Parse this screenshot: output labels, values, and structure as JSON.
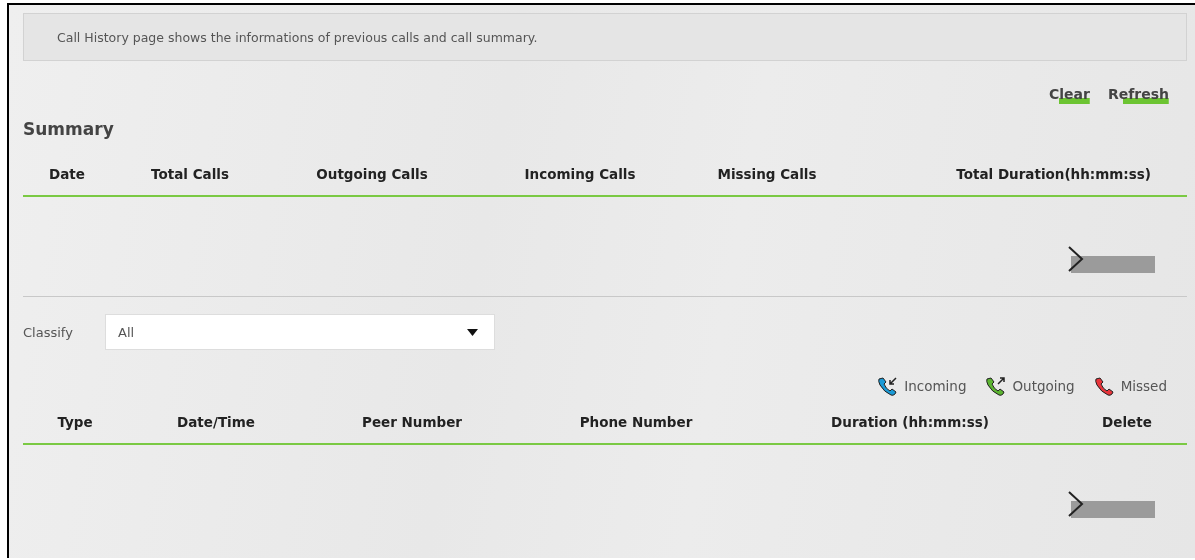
{
  "info_text": "Call History page shows the informations of previous calls and call summary.",
  "actions": [
    "Clear",
    "Refresh"
  ],
  "summary": {
    "title": "Summary",
    "columns": [
      "Date",
      "Total Calls",
      "Outgoing Calls",
      "Incoming Calls",
      "Missing Calls",
      "Total Duration(hh:mm:ss)"
    ]
  },
  "classify": {
    "label": "Classify",
    "value": "All"
  },
  "legend": [
    {
      "kind": "incoming",
      "label": "Incoming",
      "color": "#1a9ad6"
    },
    {
      "kind": "outgoing",
      "label": "Outgoing",
      "color": "#5cb531"
    },
    {
      "kind": "missed",
      "label": "Missed",
      "color": "#e8353b"
    }
  ],
  "history": {
    "columns": [
      "Type",
      "Date/Time",
      "Peer Number",
      "Phone Number",
      "Duration (hh:mm:ss)",
      "Delete"
    ]
  }
}
